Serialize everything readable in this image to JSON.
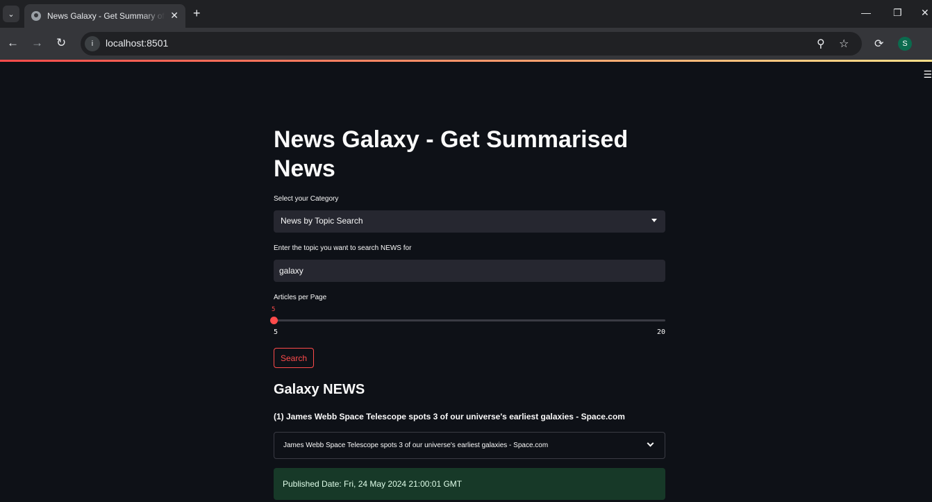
{
  "browser": {
    "tab_title": "News Galaxy - Get Summary of",
    "tab_close": "✕",
    "new_tab": "+",
    "url": "localhost:8501",
    "profile_initial": "S",
    "controls": {
      "minimize": "—",
      "restore": "❐",
      "close": "✕"
    }
  },
  "app": {
    "title": "News Galaxy - Get Summarised News",
    "category_label": "Select your Category",
    "category_value": "News by Topic Search",
    "topic_label": "Enter the topic you want to search NEWS for",
    "topic_value": "galaxy",
    "slider_label": "Articles per Page",
    "slider_value": "5",
    "slider_min": "5",
    "slider_max": "20",
    "slider_fraction": 0,
    "search_button": "Search",
    "section_heading": "Galaxy NEWS",
    "article_heading": "(1) James Webb Space Telescope spots 3 of our universe's earliest galaxies - Space.com",
    "expander_label": "James Webb Space Telescope spots 3 of our universe's earliest galaxies - Space.com",
    "published": "Published Date: Fri, 24 May 2024 21:00:01 GMT"
  },
  "colors": {
    "accent": "#ff4b4b",
    "background": "#0e1117",
    "input_bg": "#262730",
    "success_bg": "#173928"
  }
}
